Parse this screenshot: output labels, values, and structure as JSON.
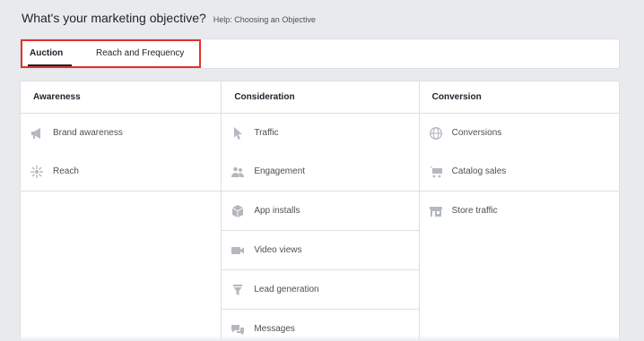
{
  "header": {
    "title": "What's your marketing objective?",
    "help_link": "Help: Choosing an Objective"
  },
  "tabs": [
    {
      "label": "Auction",
      "active": true
    },
    {
      "label": "Reach and Frequency",
      "active": false
    }
  ],
  "highlight_color": "#e0332e",
  "columns": {
    "awareness": {
      "title": "Awareness",
      "items": [
        {
          "label": "Brand awareness",
          "icon": "megaphone-icon"
        },
        {
          "label": "Reach",
          "icon": "reach-burst-icon"
        }
      ]
    },
    "consideration": {
      "title": "Consideration",
      "items": [
        {
          "label": "Traffic",
          "icon": "cursor-icon"
        },
        {
          "label": "Engagement",
          "icon": "people-icon"
        },
        {
          "label": "App installs",
          "icon": "cube-icon"
        },
        {
          "label": "Video views",
          "icon": "video-camera-icon"
        },
        {
          "label": "Lead generation",
          "icon": "funnel-icon"
        },
        {
          "label": "Messages",
          "icon": "chat-bubbles-icon"
        }
      ]
    },
    "conversion": {
      "title": "Conversion",
      "items": [
        {
          "label": "Conversions",
          "icon": "globe-icon"
        },
        {
          "label": "Catalog sales",
          "icon": "shopping-cart-icon"
        },
        {
          "label": "Store traffic",
          "icon": "store-icon"
        }
      ]
    }
  }
}
